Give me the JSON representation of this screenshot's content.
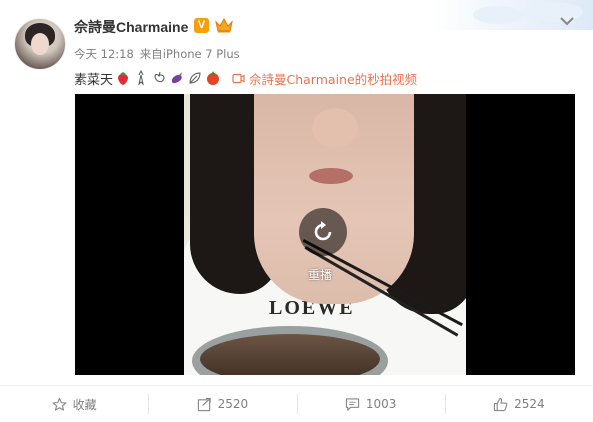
{
  "post": {
    "author_name": "佘詩曼Charmaine",
    "verified_badge": "V",
    "time": "今天 12:18",
    "source_prefix": "来自",
    "source_device": "iPhone 7 Plus",
    "text": "素菜天",
    "emojis": [
      "strawberry-icon",
      "radish-icon",
      "pepper-icon",
      "eggplant-icon",
      "leaf-icon",
      "tomato-icon"
    ],
    "video_link": "佘詩曼Charmaine的秒拍视频",
    "shirt_text": "LOEWE"
  },
  "video": {
    "replay_label": "重播"
  },
  "actions": {
    "favorite_label": "收藏",
    "repost_count": "2520",
    "comment_count": "1003",
    "like_count": "2524"
  },
  "colors": {
    "accent": "#eb7350",
    "badge": "#f7a10a",
    "text_secondary": "#808080"
  }
}
